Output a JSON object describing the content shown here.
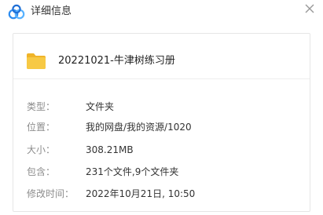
{
  "window": {
    "title": "详细信息",
    "logo_icon": "baidu-netdisk-logo-icon",
    "close_icon": "close-icon"
  },
  "file": {
    "name": "20221021-牛津树练习册",
    "icon": "folder-icon",
    "icon_color": "#f7c944"
  },
  "details": [
    {
      "label": "类型：",
      "value": "文件夹"
    },
    {
      "label": "位置：",
      "value": "我的网盘/我的资源/1020"
    },
    {
      "label": "大小：",
      "value": "308.21MB"
    },
    {
      "label": "包含：",
      "value": "231个文件,9个文件夹"
    },
    {
      "label": "修改时间：",
      "value": "2022年10月21日, 10:50"
    }
  ],
  "colors": {
    "logo_blue": "#2d8cf0",
    "logo_light_blue": "#58b2ff",
    "label_gray": "#8c8c8c",
    "text_dark": "#333333"
  }
}
